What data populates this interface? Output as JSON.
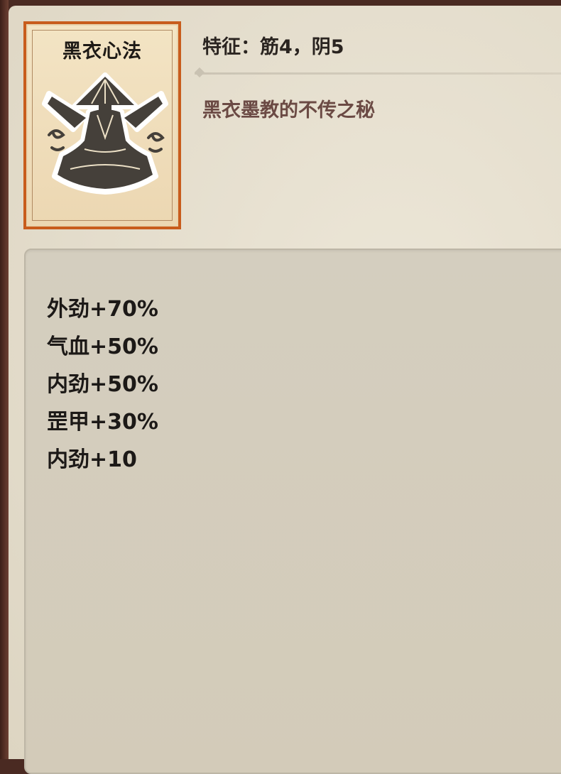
{
  "skill": {
    "name": "黑衣心法",
    "icon": "meditating-hatted-figure-icon",
    "traits": "特征：筋4，阴5",
    "description": "黑衣墨教的不传之秘"
  },
  "stats": [
    "外劲+70%",
    "气血+50%",
    "内劲+50%",
    "罡甲+30%",
    "内劲+10"
  ],
  "colors": {
    "card_border": "#c85c1c",
    "card_bg": "#f3e4c4",
    "description_text": "#6b4a44",
    "panel_bg": "#e8e2d2",
    "stats_bg": "#d6d0c0"
  }
}
